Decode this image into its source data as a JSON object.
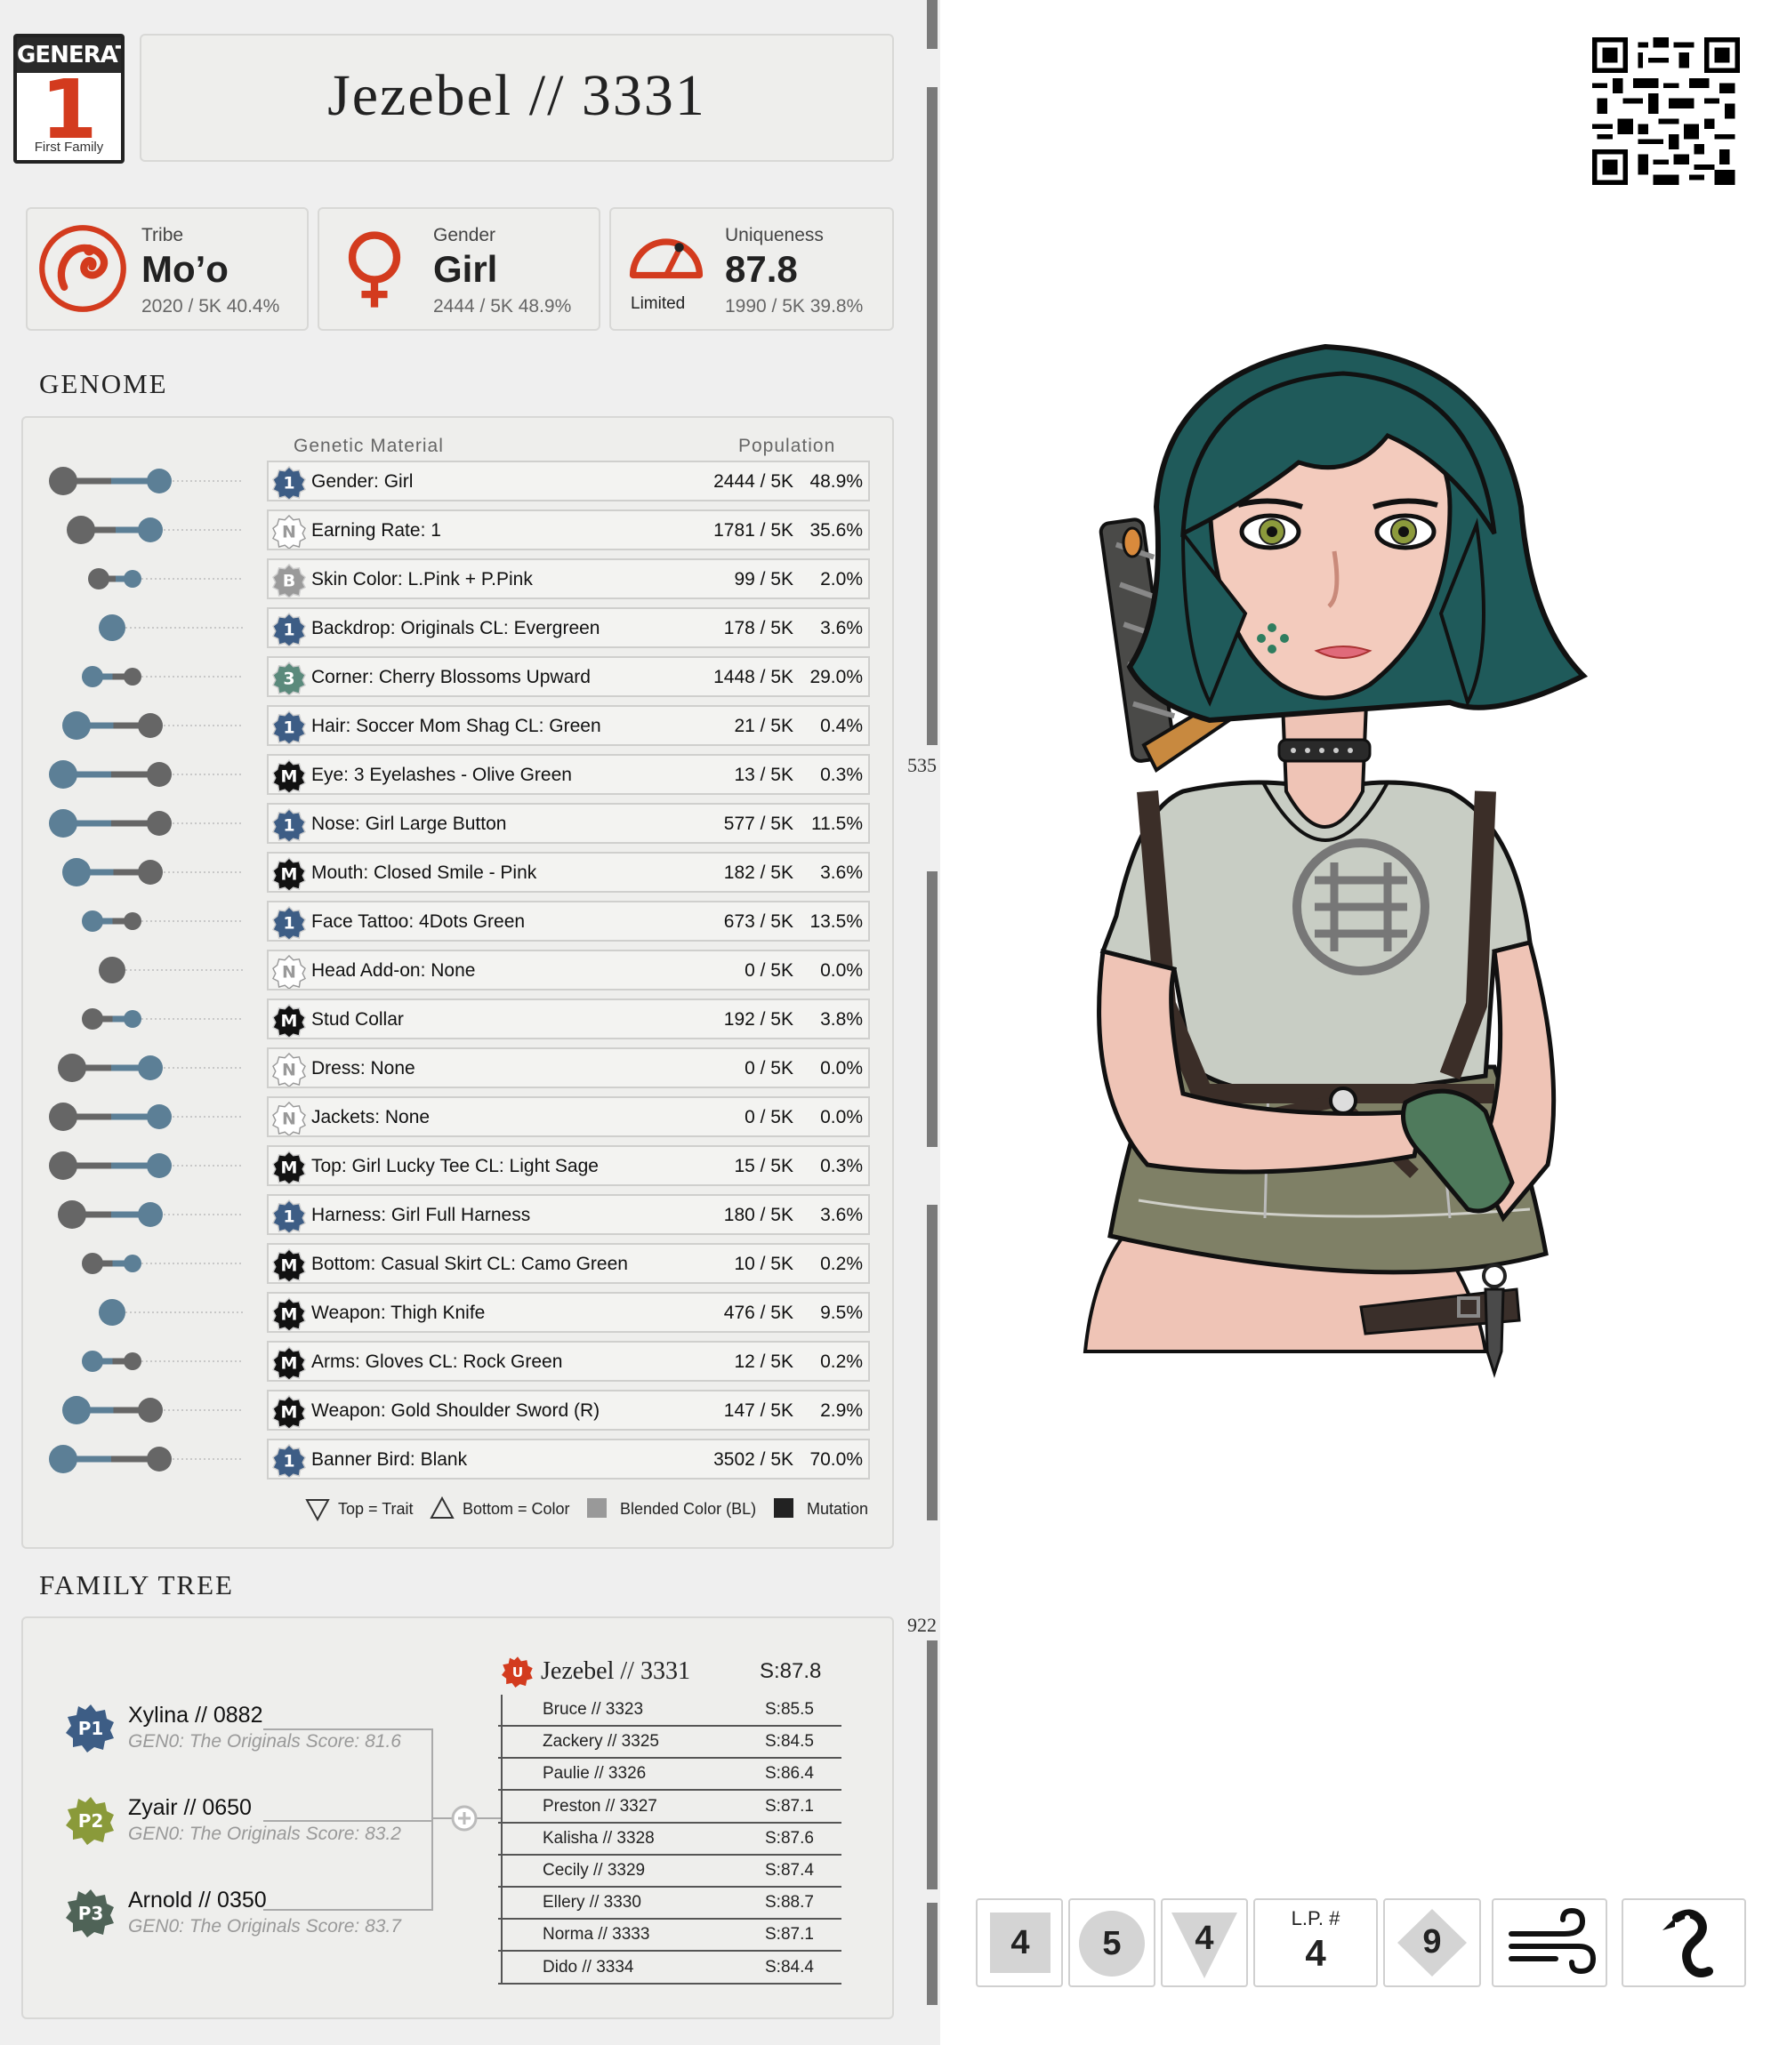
{
  "generation": {
    "label": "GENERATION",
    "number": "1",
    "family": "First Family"
  },
  "title": "Jezebel // 3331",
  "stats": {
    "tribe": {
      "label": "Tribe",
      "value": "Mo’o",
      "sub": "2020 / 5K  40.4%"
    },
    "gender": {
      "label": "Gender",
      "value": "Girl",
      "sub": "2444 / 5K  48.9%"
    },
    "uniqueness": {
      "label": "Uniqueness",
      "value": "87.8",
      "sub": "1990 / 5K  39.8%",
      "rarity": "Limited"
    }
  },
  "genome": {
    "title": "GENOME",
    "col_material": "Genetic Material",
    "col_population": "Population",
    "rows": [
      {
        "badge": "1",
        "text": "Gender: Girl",
        "count": "2444 / 5K",
        "pct": "48.9%"
      },
      {
        "badge": "N",
        "text": "Earning Rate: 1",
        "count": "1781 / 5K",
        "pct": "35.6%"
      },
      {
        "badge": "B",
        "text": "Skin Color: L.Pink + P.Pink",
        "count": "99 / 5K",
        "pct": "2.0%"
      },
      {
        "badge": "1",
        "text": "Backdrop: Originals  CL: Evergreen",
        "count": "178 / 5K",
        "pct": "3.6%"
      },
      {
        "badge": "3",
        "text": "Corner: Cherry Blossoms Upward",
        "count": "1448 / 5K",
        "pct": "29.0%"
      },
      {
        "badge": "1",
        "text": "Hair: Soccer Mom Shag CL: Green",
        "count": "21 / 5K",
        "pct": "0.4%"
      },
      {
        "badge": "M",
        "text": "Eye: 3 Eyelashes - Olive Green",
        "count": "13 / 5K",
        "pct": "0.3%"
      },
      {
        "badge": "1",
        "text": "Nose: Girl Large Button",
        "count": "577 / 5K",
        "pct": "11.5%"
      },
      {
        "badge": "M",
        "text": "Mouth: Closed Smile - Pink",
        "count": "182 / 5K",
        "pct": "3.6%"
      },
      {
        "badge": "1",
        "text": "Face Tattoo: 4Dots Green",
        "count": "673 / 5K",
        "pct": "13.5%"
      },
      {
        "badge": "N",
        "text": "Head Add-on:  None",
        "count": "0 / 5K",
        "pct": "0.0%"
      },
      {
        "badge": "M",
        "text": "Stud Collar",
        "count": "192 / 5K",
        "pct": "3.8%"
      },
      {
        "badge": "N",
        "text": "Dress: None",
        "count": "0 / 5K",
        "pct": "0.0%"
      },
      {
        "badge": "N",
        "text": "Jackets: None",
        "count": "0 / 5K",
        "pct": "0.0%"
      },
      {
        "badge": "M",
        "text": "Top: Girl Lucky Tee CL: Light Sage",
        "count": "15 / 5K",
        "pct": "0.3%"
      },
      {
        "badge": "1",
        "text": "Harness: Girl Full Harness",
        "count": "180 / 5K",
        "pct": "3.6%"
      },
      {
        "badge": "M",
        "text": "Bottom: Casual Skirt CL: Camo Green",
        "count": "10 / 5K",
        "pct": "0.2%"
      },
      {
        "badge": "M",
        "text": "Weapon: Thigh Knife",
        "count": "476 / 5K",
        "pct": "9.5%"
      },
      {
        "badge": "M",
        "text": "Arms: Gloves CL: Rock Green",
        "count": "12 / 5K",
        "pct": "0.2%"
      },
      {
        "badge": "M",
        "text": "Weapon: Gold Shoulder Sword (R)",
        "count": "147 / 5K",
        "pct": "2.9%"
      },
      {
        "badge": "1",
        "text": "Banner Bird:  Blank",
        "count": "3502 / 5K",
        "pct": "70.0%"
      }
    ],
    "legend": {
      "top": "Top = Trait",
      "bottom": "Bottom = Color",
      "blended": "Blended Color (BL)",
      "mutation": "Mutation"
    }
  },
  "family": {
    "title": "FAMILY TREE",
    "parents": [
      {
        "tag": "P1",
        "name": "Xylina  //  0882",
        "info": "GEN0: The Originals Score: 81.6"
      },
      {
        "tag": "P2",
        "name": "Zyair  //  0650",
        "info": "GEN0: The Originals Score: 83.2"
      },
      {
        "tag": "P3",
        "name": "Arnold  //  0350",
        "info": "GEN0: The Originals Score: 83.7"
      }
    ],
    "self": {
      "badge": "U",
      "name": "Jezebel // 3331",
      "score": "S:87.8"
    },
    "siblings": [
      {
        "name": "Bruce  //  3323",
        "score": "S:85.5"
      },
      {
        "name": "Zackery  //  3325",
        "score": "S:84.5"
      },
      {
        "name": "Paulie  //  3326",
        "score": "S:86.4"
      },
      {
        "name": "Preston  //  3327",
        "score": "S:87.1"
      },
      {
        "name": "Kalisha  //  3328",
        "score": "S:87.6"
      },
      {
        "name": "Cecily  //  3329",
        "score": "S:87.4"
      },
      {
        "name": "Ellery  //  3330",
        "score": "S:88.7"
      },
      {
        "name": "Norma  //  3333",
        "score": "S:87.1"
      },
      {
        "name": "Dido  //  3334",
        "score": "S:84.4"
      }
    ]
  },
  "ruler": {
    "mark1": "535",
    "mark2": "922"
  },
  "cards": {
    "c1": "4",
    "c2": "5",
    "c3": "4",
    "lp_label": "L.P. #",
    "lp_value": "4",
    "c5": "9",
    "icon_wind": "wind-icon",
    "icon_bird": "flamingo-icon"
  },
  "colors": {
    "accent": "#d33b1e",
    "badge_blue": "#3d5d85",
    "p2": "#8a9a3a",
    "p3": "#4f6357"
  }
}
